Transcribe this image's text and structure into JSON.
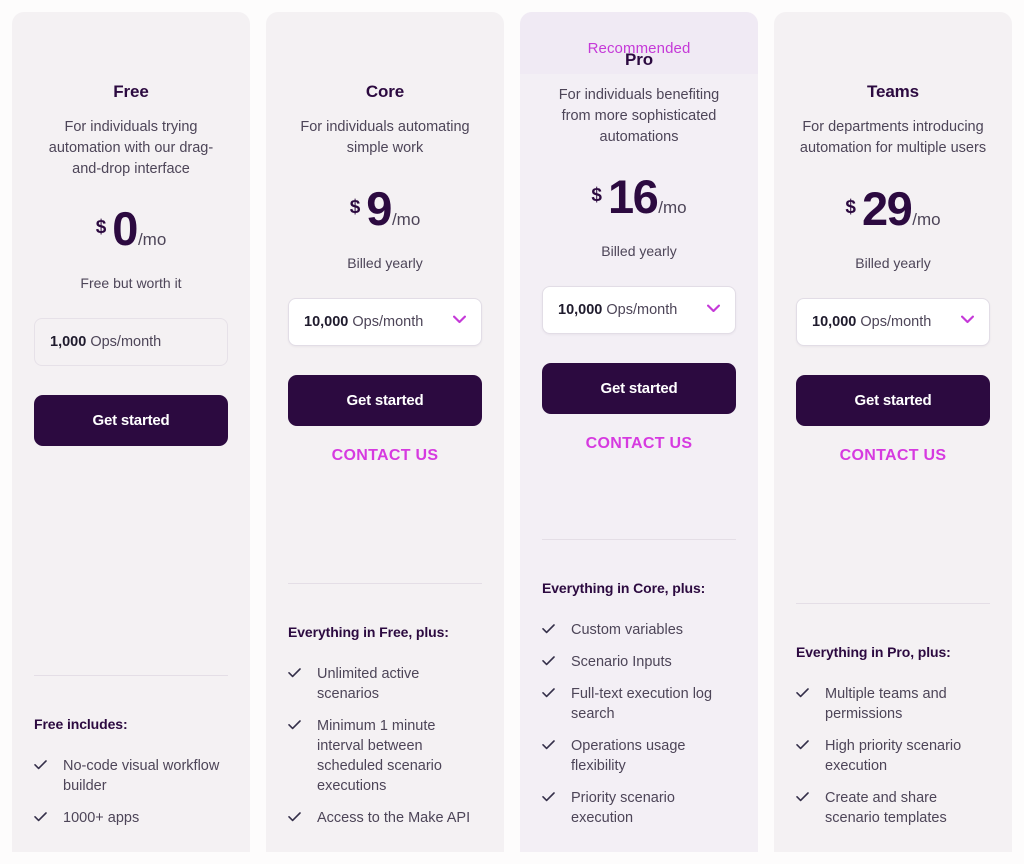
{
  "theme": {
    "page_background": "#fdfcfc",
    "card_background": "#f4f1f3",
    "recommended_card_background": "#f3eff5",
    "accent_magenta": "#d63ae0",
    "badge_color": "#c539d8",
    "dark_purple": "#2c0a40",
    "body_text": "#4d4558"
  },
  "plans": [
    {
      "id": "free",
      "badge": null,
      "name": "Free",
      "description": "For individuals trying automation with our drag-and-drop interface",
      "price": {
        "currency": "$",
        "amount": "0",
        "period": "/mo"
      },
      "billing_note": "Free but worth it",
      "ops_select": {
        "number": "1,000",
        "unit": "Ops/month",
        "enabled": false,
        "chevron_icon": "chevron-down-icon"
      },
      "cta_label": "Get started",
      "contact_label": null,
      "features_title": "Free includes:",
      "features": [
        "No-code visual workflow builder",
        "1000+ apps"
      ]
    },
    {
      "id": "core",
      "badge": null,
      "name": "Core",
      "description": "For individuals automating simple work",
      "price": {
        "currency": "$",
        "amount": "9",
        "period": "/mo"
      },
      "billing_note": "Billed yearly",
      "ops_select": {
        "number": "10,000",
        "unit": "Ops/month",
        "enabled": true,
        "chevron_icon": "chevron-down-icon"
      },
      "cta_label": "Get started",
      "contact_label": "CONTACT US",
      "features_title": "Everything in Free, plus:",
      "features": [
        "Unlimited active scenarios",
        "Minimum 1 minute interval between scheduled scenario executions",
        "Access to the Make API"
      ]
    },
    {
      "id": "pro",
      "badge": "Recommended",
      "name": "Pro",
      "description": "For individuals benefiting from more sophisticated automations",
      "price": {
        "currency": "$",
        "amount": "16",
        "period": "/mo"
      },
      "billing_note": "Billed yearly",
      "ops_select": {
        "number": "10,000",
        "unit": "Ops/month",
        "enabled": true,
        "chevron_icon": "chevron-down-icon"
      },
      "cta_label": "Get started",
      "contact_label": "CONTACT US",
      "features_title": "Everything in Core, plus:",
      "features": [
        "Custom variables",
        "Scenario Inputs",
        "Full-text execution log search",
        "Operations usage flexibility",
        "Priority scenario execution"
      ]
    },
    {
      "id": "teams",
      "badge": null,
      "name": "Teams",
      "description": "For departments introducing automation for multiple users",
      "price": {
        "currency": "$",
        "amount": "29",
        "period": "/mo"
      },
      "billing_note": "Billed yearly",
      "ops_select": {
        "number": "10,000",
        "unit": "Ops/month",
        "enabled": true,
        "chevron_icon": "chevron-down-icon"
      },
      "cta_label": "Get started",
      "contact_label": "CONTACT US",
      "features_title": "Everything in Pro, plus:",
      "features": [
        "Multiple teams and permissions",
        "High priority scenario execution",
        "Create and share scenario templates"
      ]
    }
  ]
}
